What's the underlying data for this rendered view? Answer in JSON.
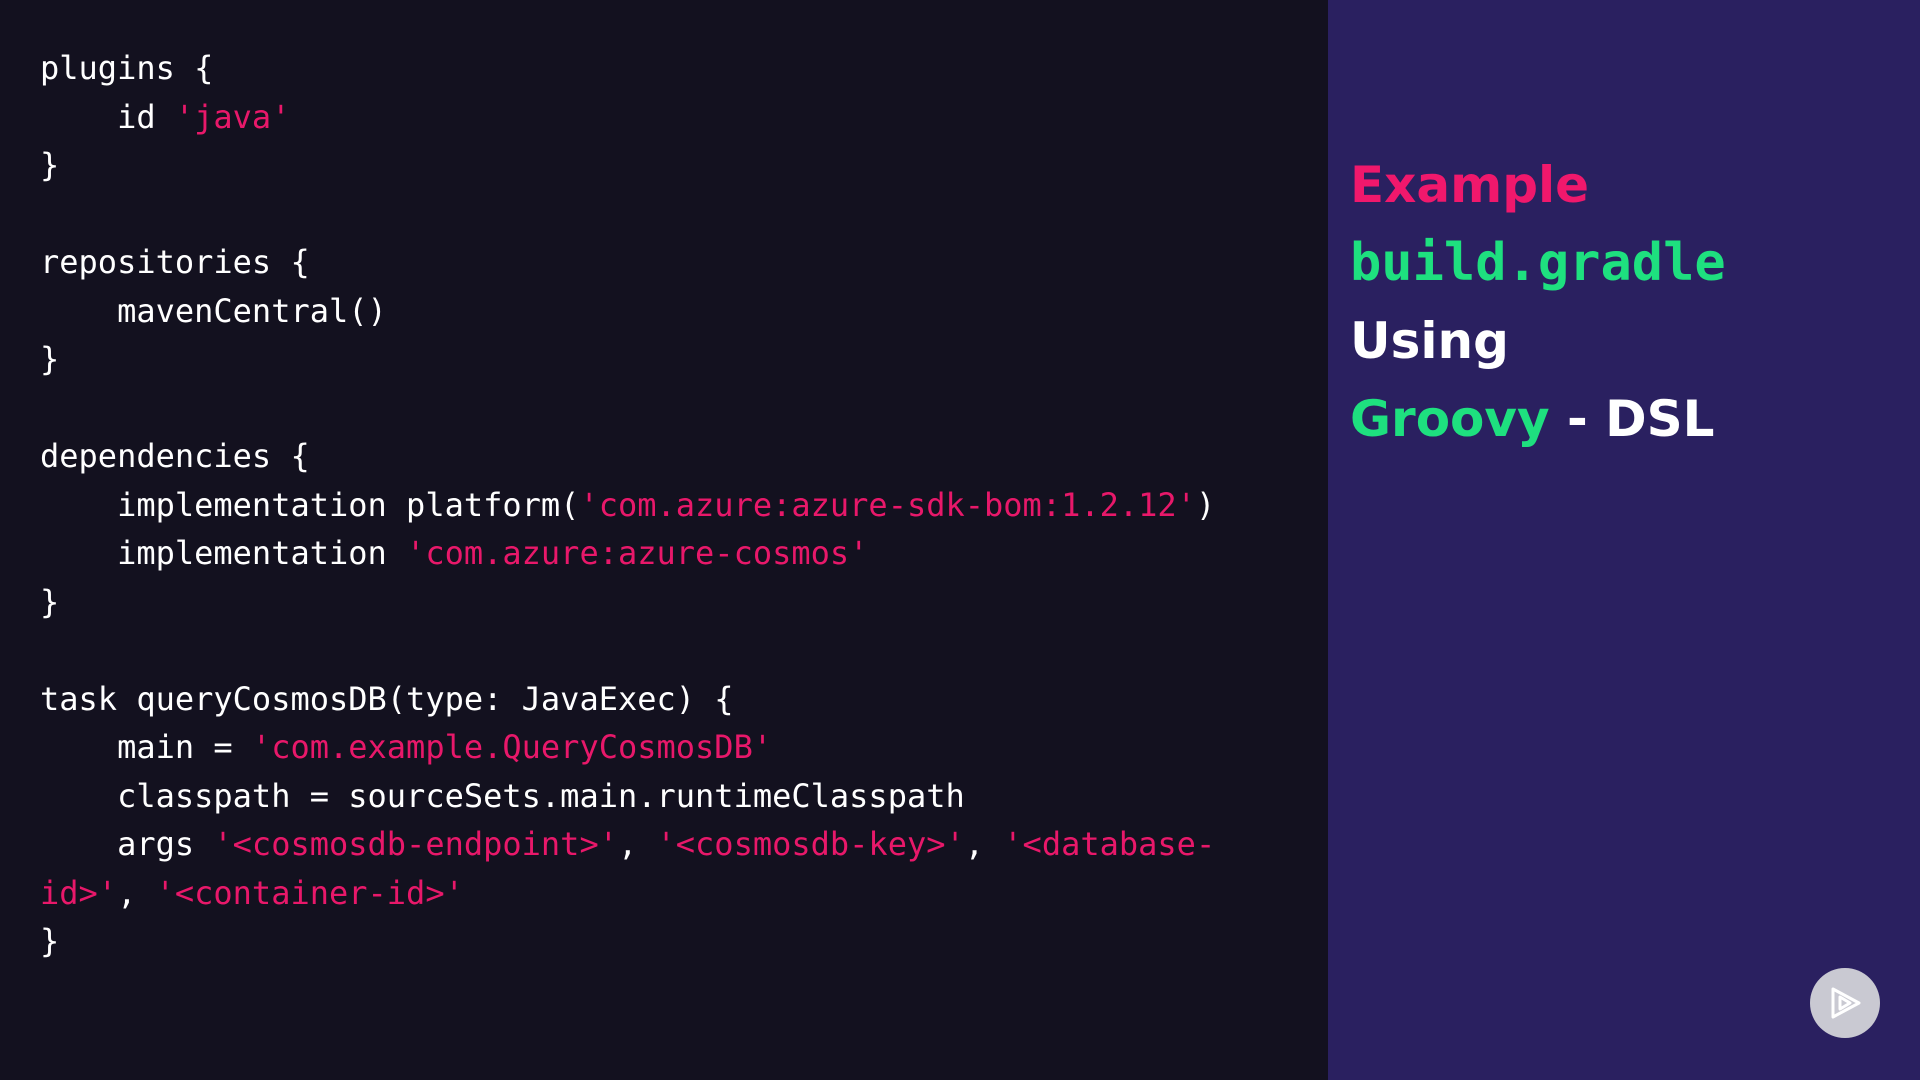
{
  "code_lines": [
    [
      {
        "t": "plugins {",
        "k": "plain"
      }
    ],
    [
      {
        "t": "    id ",
        "k": "plain"
      },
      {
        "t": "'java'",
        "k": "str"
      }
    ],
    [
      {
        "t": "}",
        "k": "plain"
      }
    ],
    [
      {
        "t": "",
        "k": "plain"
      }
    ],
    [
      {
        "t": "repositories {",
        "k": "plain"
      }
    ],
    [
      {
        "t": "    mavenCentral()",
        "k": "plain"
      }
    ],
    [
      {
        "t": "}",
        "k": "plain"
      }
    ],
    [
      {
        "t": "",
        "k": "plain"
      }
    ],
    [
      {
        "t": "dependencies {",
        "k": "plain"
      }
    ],
    [
      {
        "t": "    implementation platform(",
        "k": "plain"
      },
      {
        "t": "'com.azure:azure-sdk-bom:1.2.12'",
        "k": "str"
      },
      {
        "t": ")",
        "k": "plain"
      }
    ],
    [
      {
        "t": "    implementation ",
        "k": "plain"
      },
      {
        "t": "'com.azure:azure-cosmos'",
        "k": "str"
      }
    ],
    [
      {
        "t": "}",
        "k": "plain"
      }
    ],
    [
      {
        "t": "",
        "k": "plain"
      }
    ],
    [
      {
        "t": "task queryCosmosDB(type: JavaExec) {",
        "k": "plain"
      }
    ],
    [
      {
        "t": "    main = ",
        "k": "plain"
      },
      {
        "t": "'com.example.QueryCosmosDB'",
        "k": "str"
      }
    ],
    [
      {
        "t": "    classpath = sourceSets.main.runtimeClasspath",
        "k": "plain"
      }
    ],
    [
      {
        "t": "    args ",
        "k": "plain"
      },
      {
        "t": "'<cosmosdb-endpoint>'",
        "k": "str"
      },
      {
        "t": ", ",
        "k": "plain"
      },
      {
        "t": "'<cosmosdb-key>'",
        "k": "str"
      },
      {
        "t": ", ",
        "k": "plain"
      },
      {
        "t": "'<database-",
        "k": "str"
      }
    ],
    [
      {
        "t": "id>'",
        "k": "str"
      },
      {
        "t": ", ",
        "k": "plain"
      },
      {
        "t": "'<container-id>'",
        "k": "str"
      }
    ],
    [
      {
        "t": "}",
        "k": "plain"
      }
    ]
  ],
  "sidebar": {
    "example_label": "Example",
    "file_name": "build.gradle",
    "using_label": "Using",
    "groovy_label": "Groovy",
    "dsl_label": " - DSL"
  },
  "colors": {
    "string": "#e8186a",
    "accent_pink": "#f0186c",
    "accent_green": "#1ee07f",
    "code_bg": "#13111f",
    "side_bg": "#2a2060"
  },
  "controls": {
    "play_icon": "play-icon"
  }
}
